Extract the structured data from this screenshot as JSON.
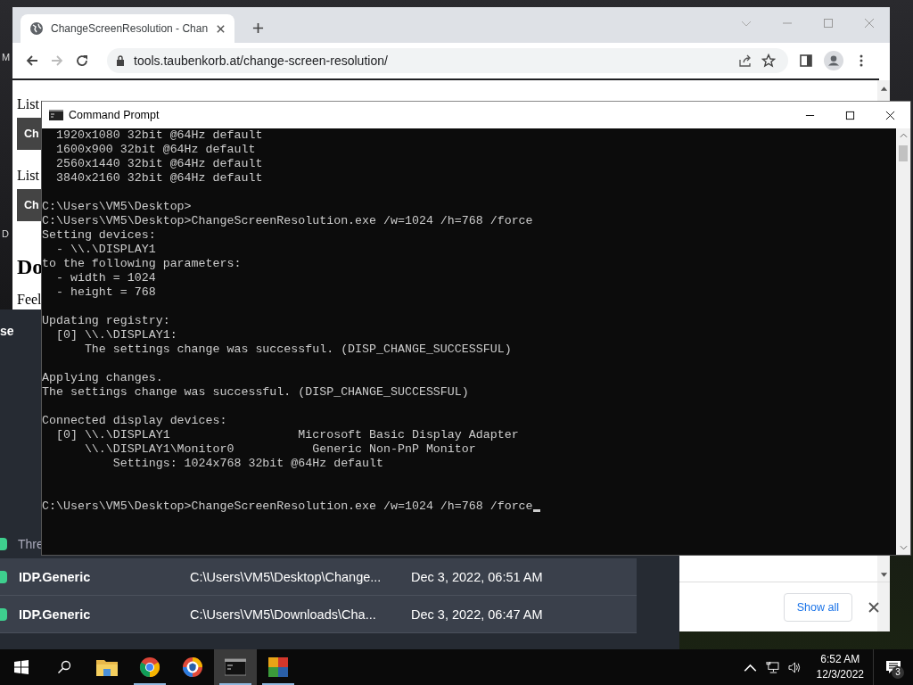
{
  "desktop_fragments": [
    "M",
    "D"
  ],
  "browser": {
    "tab_title": "ChangeScreenResolution - Chan",
    "url": "tools.taubenkorb.at/change-screen-resolution/",
    "page_fragments": [
      {
        "kind": "text",
        "text": "List"
      },
      {
        "kind": "button",
        "text": "Ch"
      },
      {
        "kind": "text",
        "text": "List"
      },
      {
        "kind": "button",
        "text": "Ch"
      },
      {
        "kind": "heading",
        "text": "Do"
      },
      {
        "kind": "text",
        "text": "Feel"
      }
    ],
    "show_all": "Show all"
  },
  "security_app": {
    "fragment": "se",
    "threat_label": "Thre",
    "rows": [
      {
        "name": "IDP.Generic",
        "path": "C:\\Users\\VM5\\Desktop\\Change...",
        "date": "Dec 3, 2022, 06:51 AM"
      },
      {
        "name": "IDP.Generic",
        "path": "C:\\Users\\VM5\\Downloads\\Cha...",
        "date": "Dec 3, 2022, 06:47 AM"
      }
    ]
  },
  "cmd": {
    "title": "Command Prompt",
    "blocks": [
      {
        "kind": "output",
        "lines": [
          "  1920x1080 32bit @64Hz default",
          "  1600x900 32bit @64Hz default",
          "  2560x1440 32bit @64Hz default",
          "  3840x2160 32bit @64Hz default"
        ]
      },
      {
        "kind": "output",
        "lines": [
          "C:\\Users\\VM5\\Desktop>",
          "C:\\Users\\VM5\\Desktop>ChangeScreenResolution.exe /w=1024 /h=768 /force",
          "Setting devices:",
          "  - \\\\.\\DISPLAY1",
          "to the following parameters:",
          "  - width = 1024",
          "  - height = 768"
        ]
      },
      {
        "kind": "output",
        "lines": [
          "Updating registry:",
          "  [0] \\\\.\\DISPLAY1:",
          "      The settings change was successful. (DISP_CHANGE_SUCCESSFUL)"
        ]
      },
      {
        "kind": "output",
        "lines": [
          "Applying changes.",
          "The settings change was successful. (DISP_CHANGE_SUCCESSFUL)"
        ]
      },
      {
        "kind": "output",
        "lines": [
          "Connected display devices:",
          "  [0] \\\\.\\DISPLAY1                  Microsoft Basic Display Adapter",
          "      \\\\.\\DISPLAY1\\Monitor0           Generic Non-PnP Monitor",
          "          Settings: 1024x768 32bit @64Hz default"
        ]
      },
      {
        "kind": "prompt",
        "lines": [
          "C:\\Users\\VM5\\Desktop>ChangeScreenResolution.exe /w=1024 /h=768 /force"
        ]
      }
    ]
  },
  "taskbar": {
    "apps": [
      {
        "kind": "folder",
        "running": false,
        "selected": false
      },
      {
        "kind": "chrome",
        "running": true,
        "selected": false
      },
      {
        "kind": "secure-browser",
        "running": false,
        "selected": false
      },
      {
        "kind": "cmd",
        "running": true,
        "selected": true
      },
      {
        "kind": "avg",
        "running": true,
        "selected": false
      }
    ],
    "time": "6:52 AM",
    "date": "12/3/2022",
    "notifications": "3"
  }
}
